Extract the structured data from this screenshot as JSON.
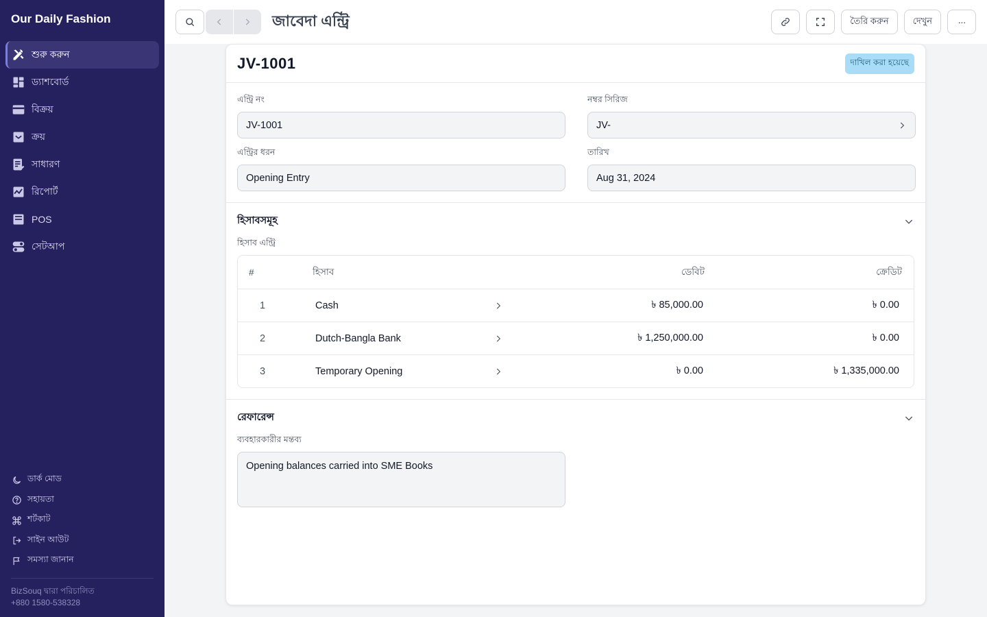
{
  "sidebar": {
    "brand": "Our Daily Fashion",
    "items": [
      {
        "label": "শুরু করুন",
        "icon": "tools-icon",
        "active": true
      },
      {
        "label": "ড্যাশবোর্ড",
        "icon": "dashboard-icon",
        "active": false
      },
      {
        "label": "বিক্রয়",
        "icon": "card-icon",
        "active": false
      },
      {
        "label": "ক্রয়",
        "icon": "inbox-icon",
        "active": false
      },
      {
        "label": "সাধারণ",
        "icon": "ledger-icon",
        "active": false
      },
      {
        "label": "রিপোর্ট",
        "icon": "chart-icon",
        "active": false
      },
      {
        "label": "POS",
        "icon": "pos-icon",
        "active": false
      },
      {
        "label": "সেটআপ",
        "icon": "toggle-icon",
        "active": false
      }
    ],
    "footer": [
      {
        "label": "ডার্ক মোড",
        "icon": "moon-icon"
      },
      {
        "label": "সহায়তা",
        "icon": "help-icon"
      },
      {
        "label": "শর্টকাট",
        "icon": "command-icon"
      },
      {
        "label": "সাইন আউট",
        "icon": "logout-icon"
      },
      {
        "label": "সমস্যা জানান",
        "icon": "flag-icon"
      }
    ],
    "powered_by": "BizSouq দ্বারা পরিচালিত",
    "phone": "+880 1580-538328"
  },
  "topbar": {
    "title": "জাবেদা এন্ট্রি",
    "create_label": "তৈরি করুন",
    "view_label": "দেখুন",
    "more_label": "···"
  },
  "doc": {
    "name": "JV-1001",
    "status": "দাখিল করা হয়েছে",
    "status_color": "#a8dcf7"
  },
  "fields": {
    "entry_no_label": "এন্ট্রি নং",
    "entry_no_value": "JV-1001",
    "series_label": "নম্বর সিরিজ",
    "series_value": "JV-",
    "entry_type_label": "এন্ট্রির ধরন",
    "entry_type_value": "Opening Entry",
    "date_label": "তারিখ",
    "date_value": "Aug 31, 2024"
  },
  "accounts_section": {
    "title": "হিসাবসমূহ",
    "sub_label": "হিসাব এন্ট্রি",
    "columns": {
      "num": "#",
      "account": "হিসাব",
      "debit": "ডেবিট",
      "credit": "ক্রেডিট"
    },
    "rows": [
      {
        "num": "1",
        "account": "Cash",
        "debit": "৳ 85,000.00",
        "credit": "৳ 0.00"
      },
      {
        "num": "2",
        "account": "Dutch-Bangla Bank",
        "debit": "৳ 1,250,000.00",
        "credit": "৳ 0.00"
      },
      {
        "num": "3",
        "account": "Temporary Opening",
        "debit": "৳ 0.00",
        "credit": "৳ 1,335,000.00"
      }
    ]
  },
  "reference_section": {
    "title": "রেফারেন্স",
    "remark_label": "ব্যবহারকারীর মন্তব্য",
    "remark_value": "Opening balances carried into SME Books"
  }
}
